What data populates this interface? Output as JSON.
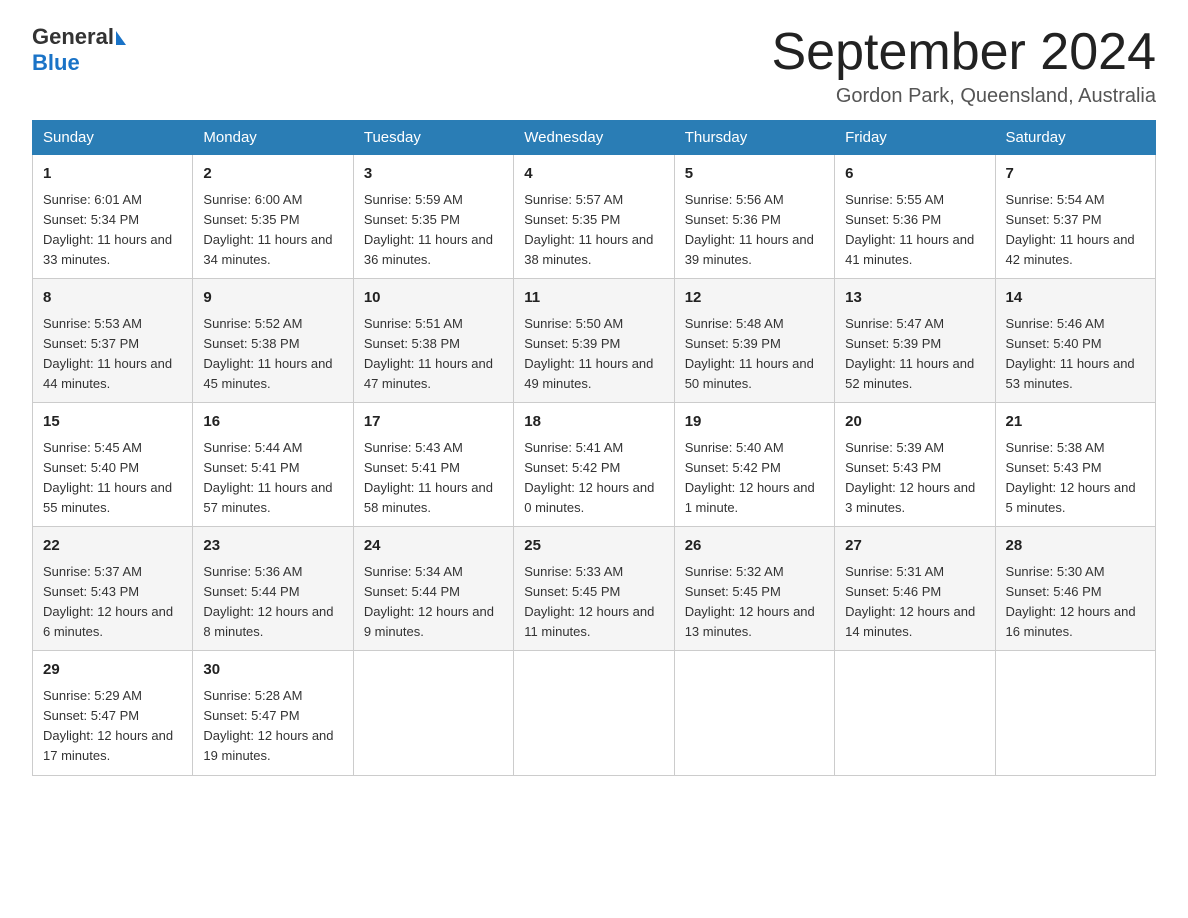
{
  "logo": {
    "general": "General",
    "blue": "Blue"
  },
  "title": "September 2024",
  "location": "Gordon Park, Queensland, Australia",
  "days_header": [
    "Sunday",
    "Monday",
    "Tuesday",
    "Wednesday",
    "Thursday",
    "Friday",
    "Saturday"
  ],
  "weeks": [
    [
      {
        "day": "1",
        "sunrise": "6:01 AM",
        "sunset": "5:34 PM",
        "daylight": "11 hours and 33 minutes."
      },
      {
        "day": "2",
        "sunrise": "6:00 AM",
        "sunset": "5:35 PM",
        "daylight": "11 hours and 34 minutes."
      },
      {
        "day": "3",
        "sunrise": "5:59 AM",
        "sunset": "5:35 PM",
        "daylight": "11 hours and 36 minutes."
      },
      {
        "day": "4",
        "sunrise": "5:57 AM",
        "sunset": "5:35 PM",
        "daylight": "11 hours and 38 minutes."
      },
      {
        "day": "5",
        "sunrise": "5:56 AM",
        "sunset": "5:36 PM",
        "daylight": "11 hours and 39 minutes."
      },
      {
        "day": "6",
        "sunrise": "5:55 AM",
        "sunset": "5:36 PM",
        "daylight": "11 hours and 41 minutes."
      },
      {
        "day": "7",
        "sunrise": "5:54 AM",
        "sunset": "5:37 PM",
        "daylight": "11 hours and 42 minutes."
      }
    ],
    [
      {
        "day": "8",
        "sunrise": "5:53 AM",
        "sunset": "5:37 PM",
        "daylight": "11 hours and 44 minutes."
      },
      {
        "day": "9",
        "sunrise": "5:52 AM",
        "sunset": "5:38 PM",
        "daylight": "11 hours and 45 minutes."
      },
      {
        "day": "10",
        "sunrise": "5:51 AM",
        "sunset": "5:38 PM",
        "daylight": "11 hours and 47 minutes."
      },
      {
        "day": "11",
        "sunrise": "5:50 AM",
        "sunset": "5:39 PM",
        "daylight": "11 hours and 49 minutes."
      },
      {
        "day": "12",
        "sunrise": "5:48 AM",
        "sunset": "5:39 PM",
        "daylight": "11 hours and 50 minutes."
      },
      {
        "day": "13",
        "sunrise": "5:47 AM",
        "sunset": "5:39 PM",
        "daylight": "11 hours and 52 minutes."
      },
      {
        "day": "14",
        "sunrise": "5:46 AM",
        "sunset": "5:40 PM",
        "daylight": "11 hours and 53 minutes."
      }
    ],
    [
      {
        "day": "15",
        "sunrise": "5:45 AM",
        "sunset": "5:40 PM",
        "daylight": "11 hours and 55 minutes."
      },
      {
        "day": "16",
        "sunrise": "5:44 AM",
        "sunset": "5:41 PM",
        "daylight": "11 hours and 57 minutes."
      },
      {
        "day": "17",
        "sunrise": "5:43 AM",
        "sunset": "5:41 PM",
        "daylight": "11 hours and 58 minutes."
      },
      {
        "day": "18",
        "sunrise": "5:41 AM",
        "sunset": "5:42 PM",
        "daylight": "12 hours and 0 minutes."
      },
      {
        "day": "19",
        "sunrise": "5:40 AM",
        "sunset": "5:42 PM",
        "daylight": "12 hours and 1 minute."
      },
      {
        "day": "20",
        "sunrise": "5:39 AM",
        "sunset": "5:43 PM",
        "daylight": "12 hours and 3 minutes."
      },
      {
        "day": "21",
        "sunrise": "5:38 AM",
        "sunset": "5:43 PM",
        "daylight": "12 hours and 5 minutes."
      }
    ],
    [
      {
        "day": "22",
        "sunrise": "5:37 AM",
        "sunset": "5:43 PM",
        "daylight": "12 hours and 6 minutes."
      },
      {
        "day": "23",
        "sunrise": "5:36 AM",
        "sunset": "5:44 PM",
        "daylight": "12 hours and 8 minutes."
      },
      {
        "day": "24",
        "sunrise": "5:34 AM",
        "sunset": "5:44 PM",
        "daylight": "12 hours and 9 minutes."
      },
      {
        "day": "25",
        "sunrise": "5:33 AM",
        "sunset": "5:45 PM",
        "daylight": "12 hours and 11 minutes."
      },
      {
        "day": "26",
        "sunrise": "5:32 AM",
        "sunset": "5:45 PM",
        "daylight": "12 hours and 13 minutes."
      },
      {
        "day": "27",
        "sunrise": "5:31 AM",
        "sunset": "5:46 PM",
        "daylight": "12 hours and 14 minutes."
      },
      {
        "day": "28",
        "sunrise": "5:30 AM",
        "sunset": "5:46 PM",
        "daylight": "12 hours and 16 minutes."
      }
    ],
    [
      {
        "day": "29",
        "sunrise": "5:29 AM",
        "sunset": "5:47 PM",
        "daylight": "12 hours and 17 minutes."
      },
      {
        "day": "30",
        "sunrise": "5:28 AM",
        "sunset": "5:47 PM",
        "daylight": "12 hours and 19 minutes."
      },
      null,
      null,
      null,
      null,
      null
    ]
  ],
  "labels": {
    "sunrise": "Sunrise:",
    "sunset": "Sunset:",
    "daylight": "Daylight:"
  }
}
